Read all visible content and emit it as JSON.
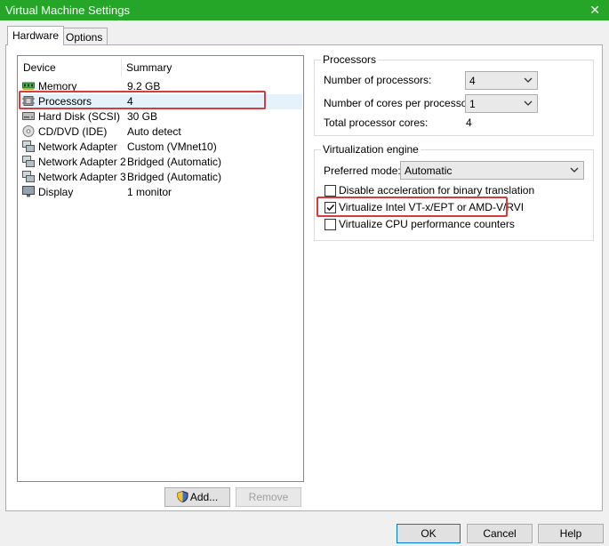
{
  "window": {
    "title": "Virtual Machine Settings",
    "close_glyph": "✕"
  },
  "tabs": [
    {
      "label": "Hardware",
      "active": true
    },
    {
      "label": "Options",
      "active": false
    }
  ],
  "device_list": {
    "col_device": "Device",
    "col_summary": "Summary",
    "rows": [
      {
        "device": "Memory",
        "summary": "9.2 GB",
        "icon": "memory-icon"
      },
      {
        "device": "Processors",
        "summary": "4",
        "icon": "processor-icon",
        "selected": true
      },
      {
        "device": "Hard Disk (SCSI)",
        "summary": "30 GB",
        "icon": "hard-disk-icon"
      },
      {
        "device": "CD/DVD (IDE)",
        "summary": "Auto detect",
        "icon": "cd-dvd-icon"
      },
      {
        "device": "Network Adapter",
        "summary": "Custom (VMnet10)",
        "icon": "network-adapter-icon"
      },
      {
        "device": "Network Adapter 2",
        "summary": "Bridged (Automatic)",
        "icon": "network-adapter-icon"
      },
      {
        "device": "Network Adapter 3",
        "summary": "Bridged (Automatic)",
        "icon": "network-adapter-icon"
      },
      {
        "device": "Display",
        "summary": "1 monitor",
        "icon": "display-icon"
      }
    ],
    "add_label": "Add...",
    "remove_label": "Remove"
  },
  "processors": {
    "title": "Processors",
    "num_processors_label": "Number of processors:",
    "num_processors_value": "4",
    "cores_label": "Number of cores per processor:",
    "cores_value": "1",
    "total_label": "Total processor cores:",
    "total_value": "4"
  },
  "virtualization": {
    "title": "Virtualization engine",
    "preferred_label": "Preferred mode:",
    "preferred_value": "Automatic",
    "options": [
      {
        "label": "Disable acceleration for binary translation",
        "checked": false
      },
      {
        "label": "Virtualize Intel VT-x/EPT or AMD-V/RVI",
        "checked": true
      },
      {
        "label": "Virtualize CPU performance counters",
        "checked": false
      }
    ]
  },
  "footer": {
    "ok": "OK",
    "cancel": "Cancel",
    "help": "Help"
  },
  "colors": {
    "titlebar": "#25a628",
    "highlight": "#d83b3b",
    "selection": "#e5f1fb"
  }
}
